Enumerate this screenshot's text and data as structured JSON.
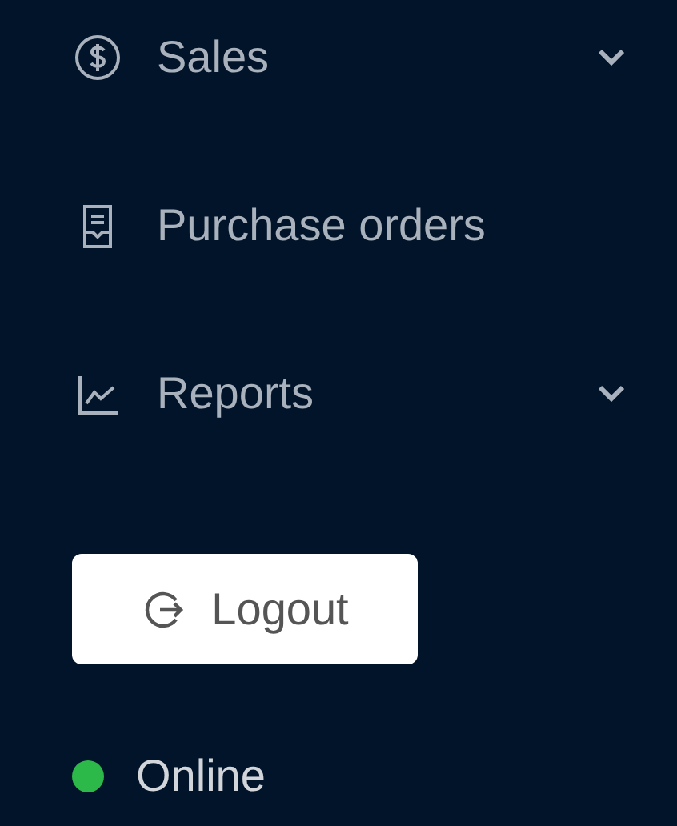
{
  "menu_items": [
    {
      "label": "Sales",
      "expandable": true
    },
    {
      "label": "Purchase orders",
      "expandable": false
    },
    {
      "label": "Reports",
      "expandable": true
    }
  ],
  "logout_button": {
    "label": "Logout"
  },
  "status": {
    "label": "Online",
    "online": true
  }
}
